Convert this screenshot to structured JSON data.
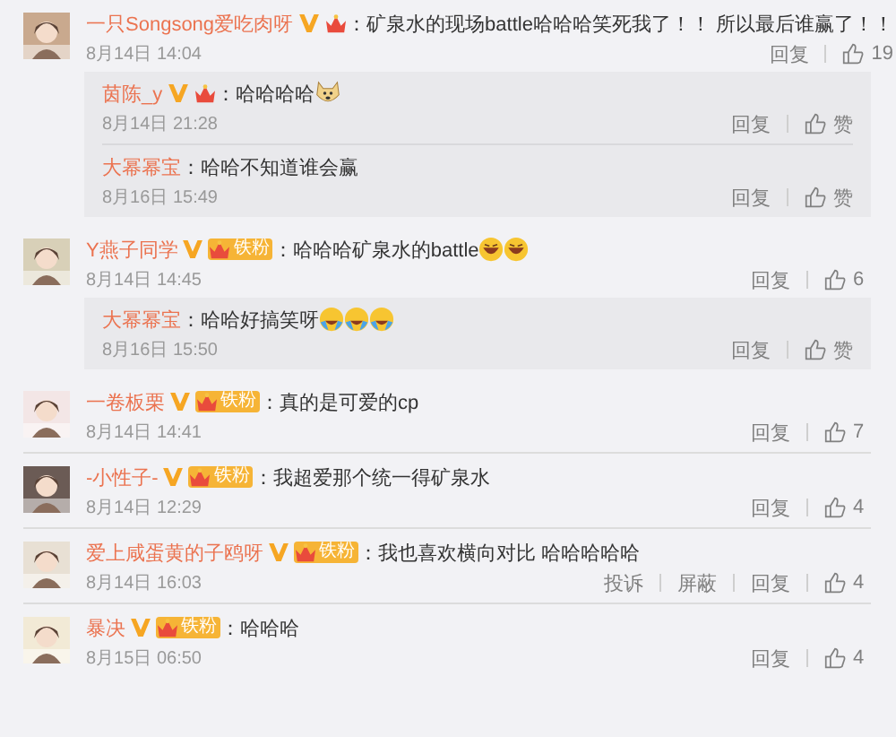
{
  "comments": [
    {
      "name": "一只Songsong爱吃肉呀",
      "text": "：矿泉水的现场battle哈哈哈笑死我了！！ 所以最后谁赢了！！",
      "time": "8月14日 14:04",
      "actions": [
        "回复"
      ],
      "likes": "19",
      "replies": [
        {
          "name": "茵陈_y",
          "verified": true,
          "text": "：哈哈哈哈",
          "emojis": [
            {
              "kind": "dog"
            }
          ],
          "time": "8月14日 21:28",
          "actions": [
            "回复"
          ],
          "like": "赞"
        },
        {
          "name": "大幂幂宝",
          "verified": false,
          "text": "：哈哈不知道谁会赢",
          "time": "8月16日 15:49",
          "actions": [
            "回复"
          ],
          "like": "赞"
        }
      ]
    },
    {
      "name": "Y燕子同学",
      "fan_label": "铁粉",
      "text": "：哈哈哈矿泉水的battle",
      "emojis": [
        {
          "kind": "laugh"
        },
        {
          "kind": "laugh"
        }
      ],
      "time": "8月14日 14:45",
      "actions": [
        "回复"
      ],
      "likes": "6",
      "replies": [
        {
          "name": "大幂幂宝",
          "verified": false,
          "text": "：哈哈好搞笑呀",
          "emojis": [
            {
              "kind": "cry"
            },
            {
              "kind": "cry"
            },
            {
              "kind": "cry"
            }
          ],
          "time": "8月16日 15:50",
          "actions": [
            "回复"
          ],
          "like": "赞"
        }
      ]
    },
    {
      "name": "一卷板栗",
      "fan_label": "铁粉",
      "text": "：真的是可爱的cp",
      "time": "8月14日 14:41",
      "actions": [
        "回复"
      ],
      "likes": "7"
    },
    {
      "name": "-小性子-",
      "fan_label": "铁粉",
      "text": "：我超爱那个统一得矿泉水",
      "time": "8月14日 12:29",
      "actions": [
        "回复"
      ],
      "likes": "4"
    },
    {
      "name": "爱上咸蛋黄的子鸥呀",
      "fan_label": "铁粉",
      "text": "：我也喜欢横向对比 哈哈哈哈哈",
      "time": "8月14日 16:03",
      "actions": [
        "投诉",
        "屏蔽",
        "回复"
      ],
      "likes": "4"
    },
    {
      "name": "暴决",
      "fan_label": "铁粉",
      "text": "：哈哈哈",
      "time": "8月15日 06:50",
      "actions": [
        "回复"
      ],
      "likes": "4"
    }
  ]
}
